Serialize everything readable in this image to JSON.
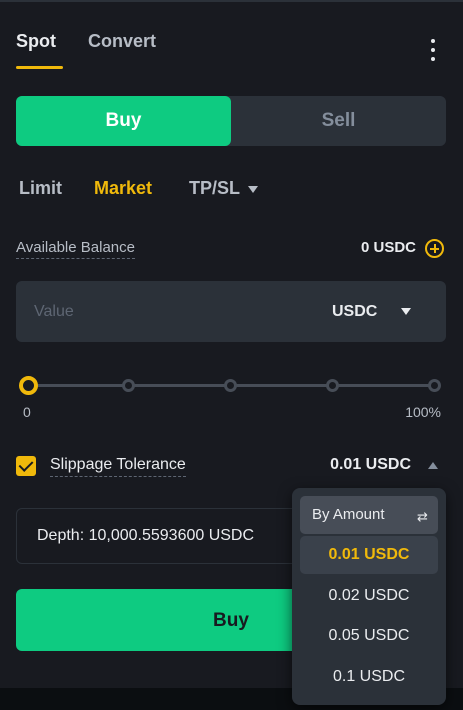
{
  "tabs": {
    "spot": "Spot",
    "convert": "Convert"
  },
  "side": {
    "buy": "Buy",
    "sell": "Sell"
  },
  "order_types": {
    "limit": "Limit",
    "market": "Market",
    "tpsl": "TP/SL"
  },
  "balance": {
    "label": "Available Balance",
    "value": "0 USDC"
  },
  "value_input": {
    "placeholder": "Value",
    "unit": "USDC"
  },
  "slider": {
    "min_label": "0",
    "max_label": "100%",
    "value_percent": 0
  },
  "slippage": {
    "label": "Slippage Tolerance",
    "value": "0.01 USDC",
    "checked": true
  },
  "depth": {
    "text": "Depth: 10,000.5593600 USDC"
  },
  "submit": {
    "label": "Buy"
  },
  "slippage_dropdown": {
    "mode_label": "By Amount",
    "options": [
      "0.01 USDC",
      "0.02 USDC",
      "0.05 USDC",
      "0.1 USDC"
    ],
    "selected": "0.01 USDC"
  },
  "colors": {
    "accent": "#f0b90b",
    "buy": "#0ecb81",
    "panel": "#181a20",
    "field": "#2b3139"
  }
}
